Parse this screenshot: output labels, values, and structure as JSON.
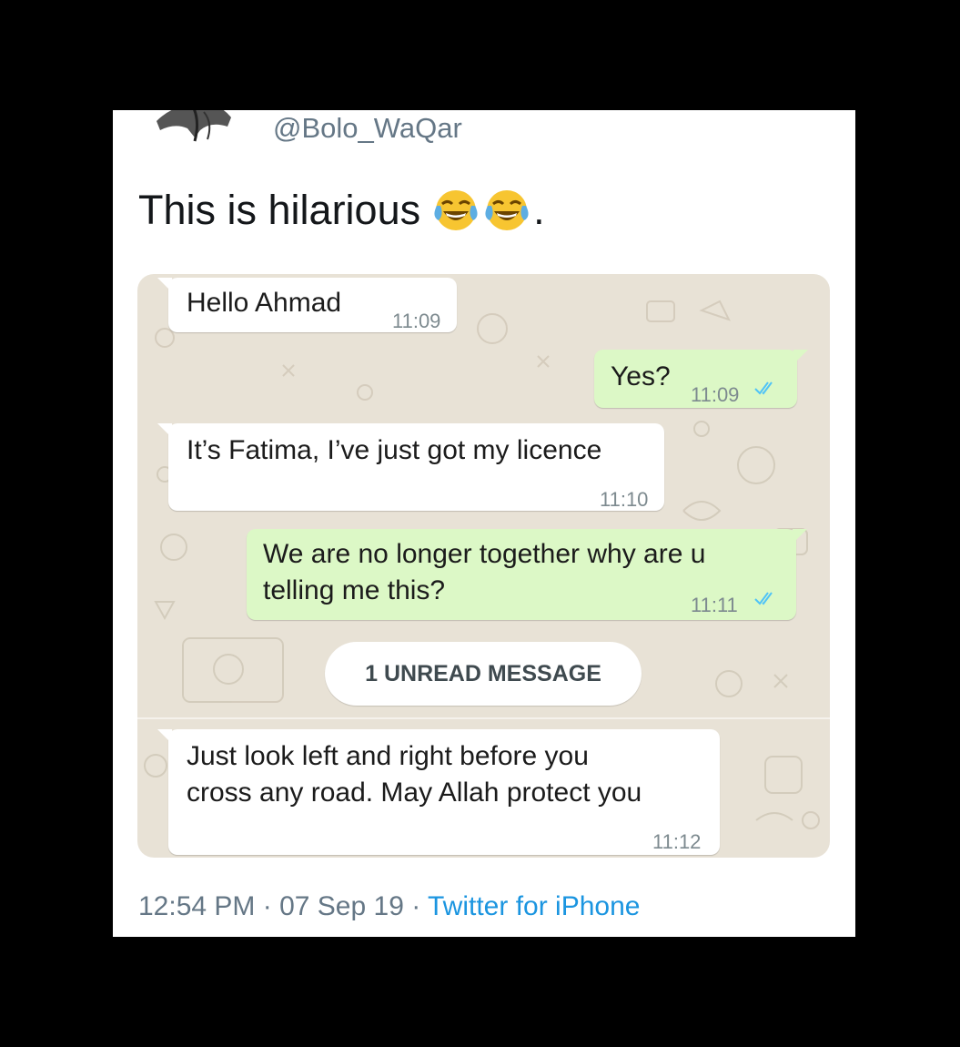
{
  "tweet": {
    "handle": "@Bolo_WaQar",
    "text": "This is hilarious",
    "emojis": [
      "face-with-tears-of-joy",
      "face-with-tears-of-joy"
    ],
    "text_suffix": ".",
    "footer": {
      "time": "12:54 PM",
      "separator1": " · ",
      "date": "07 Sep 19",
      "separator2": " · ",
      "source": "Twitter for iPhone"
    }
  },
  "chat": {
    "messages": [
      {
        "direction": "in",
        "text": "Hello Ahmad",
        "time": "11:09"
      },
      {
        "direction": "out",
        "text": "Yes?",
        "time": "11:09",
        "status": "read"
      },
      {
        "direction": "in",
        "text": "It’s Fatima, I’ve just got my licence",
        "time": "11:10"
      },
      {
        "direction": "out",
        "lines": [
          "We are no longer together why are u",
          "telling me this?"
        ],
        "time": "11:11",
        "status": "read"
      },
      {
        "direction": "in",
        "lines": [
          "Just look left and right before you",
          "cross any road. May Allah protect you"
        ],
        "time": "11:12"
      }
    ],
    "unread_label": "1 UNREAD MESSAGE"
  },
  "colors": {
    "background": "#000000",
    "card": "#ffffff",
    "chat_wallpaper": "#e8e2d6",
    "incoming_bubble": "#ffffff",
    "outgoing_bubble": "#dcf8c6",
    "read_ticks": "#4fc3f7",
    "handle_text": "#657786",
    "source_link": "#1b95e0"
  }
}
